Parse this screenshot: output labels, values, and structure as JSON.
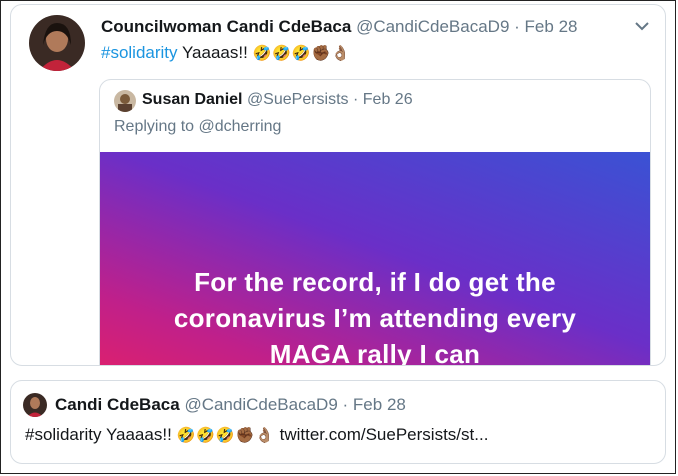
{
  "tweet": {
    "author_name": "Councilwoman Candi CdeBaca",
    "handle": "@CandiCdeBacaD9",
    "separator": "·",
    "date": "Feb 28",
    "hashtag": "#solidarity",
    "text": " Yaaaas!! ",
    "emojis": "🤣🤣🤣✊🏾👌🏽",
    "quoted": {
      "author_name": "Susan Daniel",
      "handle": "@SuePersists",
      "separator": "·",
      "date": "Feb 26",
      "replying_to": "Replying to @dcherring",
      "image_text_line1": "For the record, if I do get the",
      "image_text_line2": "coronavirus I’m attending every",
      "image_text_line3": "MAGA rally I can"
    }
  },
  "tweet2": {
    "author_name": "Candi CdeBaca",
    "handle": "@CandiCdeBacaD9",
    "separator": "·",
    "date": "Feb 28",
    "text": "#solidarity Yaaaas!! ",
    "emojis": "🤣🤣🤣✊🏾👌🏽",
    "link": " twitter.com/SuePersists/st..."
  },
  "colors": {
    "hashtag": "#1b95e0",
    "muted": "#657786",
    "border": "#d7dde3"
  },
  "icons": [
    "chevron-down-icon",
    "avatar"
  ]
}
